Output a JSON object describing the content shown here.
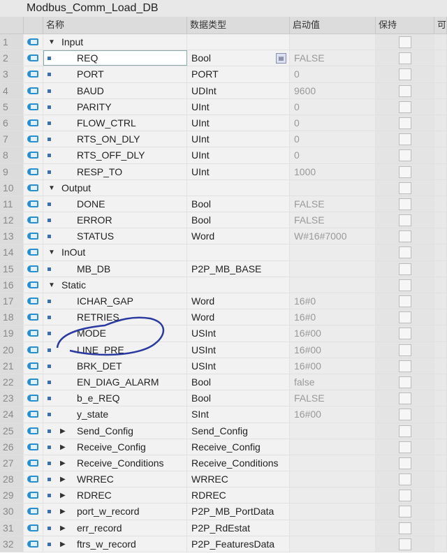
{
  "title": "Modbus_Comm_Load_DB",
  "columns": {
    "name": "名称",
    "type": "数据类型",
    "start": "启动值",
    "retain": "保持",
    "extra": "可"
  },
  "rows": [
    {
      "n": "1",
      "name": "Input",
      "type": "",
      "start": "",
      "level": 0,
      "kind": "section"
    },
    {
      "n": "2",
      "name": "REQ",
      "type": "Bool",
      "start": "FALSE",
      "level": 1,
      "kind": "var"
    },
    {
      "n": "3",
      "name": "PORT",
      "type": "PORT",
      "start": "0",
      "level": 1,
      "kind": "var"
    },
    {
      "n": "4",
      "name": "BAUD",
      "type": "UDInt",
      "start": "9600",
      "level": 1,
      "kind": "var"
    },
    {
      "n": "5",
      "name": "PARITY",
      "type": "UInt",
      "start": "0",
      "level": 1,
      "kind": "var"
    },
    {
      "n": "6",
      "name": "FLOW_CTRL",
      "type": "UInt",
      "start": "0",
      "level": 1,
      "kind": "var"
    },
    {
      "n": "7",
      "name": "RTS_ON_DLY",
      "type": "UInt",
      "start": "0",
      "level": 1,
      "kind": "var"
    },
    {
      "n": "8",
      "name": "RTS_OFF_DLY",
      "type": "UInt",
      "start": "0",
      "level": 1,
      "kind": "var"
    },
    {
      "n": "9",
      "name": "RESP_TO",
      "type": "UInt",
      "start": "1000",
      "level": 1,
      "kind": "var"
    },
    {
      "n": "10",
      "name": "Output",
      "type": "",
      "start": "",
      "level": 0,
      "kind": "section"
    },
    {
      "n": "11",
      "name": "DONE",
      "type": "Bool",
      "start": "FALSE",
      "level": 1,
      "kind": "var"
    },
    {
      "n": "12",
      "name": "ERROR",
      "type": "Bool",
      "start": "FALSE",
      "level": 1,
      "kind": "var"
    },
    {
      "n": "13",
      "name": "STATUS",
      "type": "Word",
      "start": "W#16#7000",
      "level": 1,
      "kind": "var"
    },
    {
      "n": "14",
      "name": "InOut",
      "type": "",
      "start": "",
      "level": 0,
      "kind": "section"
    },
    {
      "n": "15",
      "name": "MB_DB",
      "type": "P2P_MB_BASE",
      "start": "",
      "level": 1,
      "kind": "var"
    },
    {
      "n": "16",
      "name": "Static",
      "type": "",
      "start": "",
      "level": 0,
      "kind": "section"
    },
    {
      "n": "17",
      "name": "ICHAR_GAP",
      "type": "Word",
      "start": "16#0",
      "level": 1,
      "kind": "var"
    },
    {
      "n": "18",
      "name": "RETRIES",
      "type": "Word",
      "start": "16#0",
      "level": 1,
      "kind": "var"
    },
    {
      "n": "19",
      "name": "MODE",
      "type": "USInt",
      "start": "16#00",
      "level": 1,
      "kind": "var"
    },
    {
      "n": "20",
      "name": "LINE_PRE",
      "type": "USInt",
      "start": "16#00",
      "level": 1,
      "kind": "var"
    },
    {
      "n": "21",
      "name": "BRK_DET",
      "type": "USInt",
      "start": "16#00",
      "level": 1,
      "kind": "var"
    },
    {
      "n": "22",
      "name": "EN_DIAG_ALARM",
      "type": "Bool",
      "start": "false",
      "level": 1,
      "kind": "var"
    },
    {
      "n": "23",
      "name": "b_e_REQ",
      "type": "Bool",
      "start": "FALSE",
      "level": 1,
      "kind": "var"
    },
    {
      "n": "24",
      "name": "y_state",
      "type": "SInt",
      "start": "16#00",
      "level": 1,
      "kind": "var"
    },
    {
      "n": "25",
      "name": "Send_Config",
      "type": "Send_Config",
      "start": "",
      "level": 1,
      "kind": "struct"
    },
    {
      "n": "26",
      "name": "Receive_Config",
      "type": "Receive_Config",
      "start": "",
      "level": 1,
      "kind": "struct"
    },
    {
      "n": "27",
      "name": "Receive_Conditions",
      "type": "Receive_Conditions",
      "start": "",
      "level": 1,
      "kind": "struct"
    },
    {
      "n": "28",
      "name": "WRREC",
      "type": "WRREC",
      "start": "",
      "level": 1,
      "kind": "struct"
    },
    {
      "n": "29",
      "name": "RDREC",
      "type": "RDREC",
      "start": "",
      "level": 1,
      "kind": "struct"
    },
    {
      "n": "30",
      "name": "port_w_record",
      "type": "P2P_MB_PortData",
      "start": "",
      "level": 1,
      "kind": "struct"
    },
    {
      "n": "31",
      "name": "err_record",
      "type": "P2P_RdEstat",
      "start": "",
      "level": 1,
      "kind": "struct"
    },
    {
      "n": "32",
      "name": "ftrs_w_record",
      "type": "P2P_FeaturesData",
      "start": "",
      "level": 1,
      "kind": "struct"
    }
  ]
}
